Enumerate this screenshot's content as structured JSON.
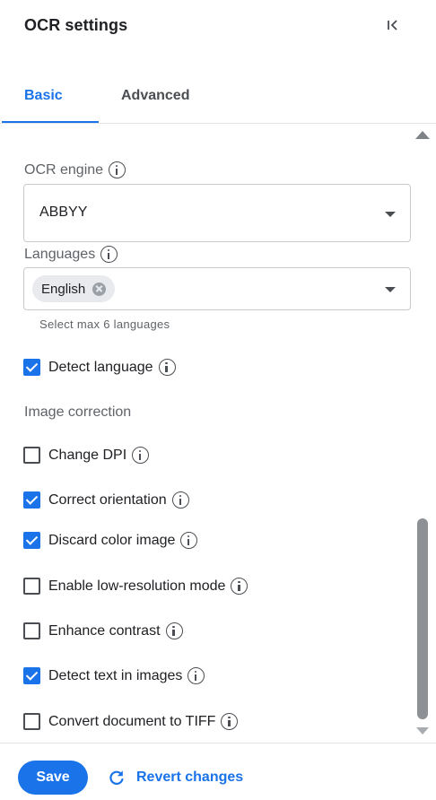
{
  "panel": {
    "title": "OCR settings",
    "collapse_icon": "collapse-panel-icon"
  },
  "tabs": [
    {
      "label": "Basic",
      "active": true
    },
    {
      "label": "Advanced",
      "active": false
    }
  ],
  "ocr_engine": {
    "label": "OCR engine",
    "value": "ABBYY"
  },
  "languages": {
    "label": "Languages",
    "chips": [
      "English"
    ],
    "helper": "Select max 6 languages"
  },
  "detect_language": {
    "label": "Detect language",
    "checked": true
  },
  "image_correction": {
    "label": "Image correction",
    "options": [
      {
        "label": "Change DPI",
        "checked": false
      },
      {
        "label": "Correct orientation",
        "checked": true
      },
      {
        "label": "Discard color image",
        "checked": true
      },
      {
        "label": "Enable low-resolution mode",
        "checked": false
      },
      {
        "label": "Enhance contrast",
        "checked": false
      },
      {
        "label": "Detect text in images",
        "checked": true
      },
      {
        "label": "Convert document to TIFF",
        "checked": false
      }
    ]
  },
  "footer": {
    "save_label": "Save",
    "revert_label": "Revert changes"
  },
  "colors": {
    "accent": "#1a73e8",
    "text": "#202124",
    "muted": "#5f6368"
  }
}
